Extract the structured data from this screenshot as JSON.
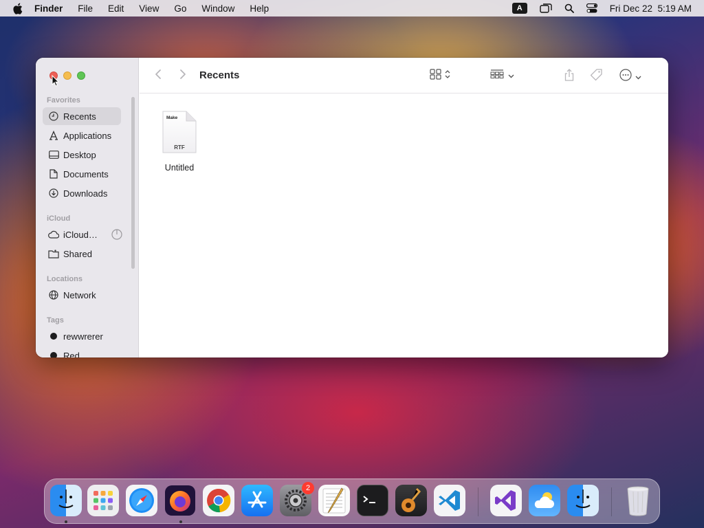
{
  "menubar": {
    "app_name": "Finder",
    "items": [
      "File",
      "Edit",
      "View",
      "Go",
      "Window",
      "Help"
    ],
    "keyboard_indicator": "A",
    "clock": "Fri Dec 22  5:19 AM",
    "icons": [
      "apple-icon",
      "screen-mirroring-icon",
      "spotlight-icon",
      "control-center-icon"
    ]
  },
  "window": {
    "title": "Recents",
    "sidebar": {
      "favorites_header": "Favorites",
      "favorites": [
        {
          "label": "Recents",
          "icon": "clock-icon",
          "selected": true
        },
        {
          "label": "Applications",
          "icon": "applications-icon"
        },
        {
          "label": "Desktop",
          "icon": "desktop-icon"
        },
        {
          "label": "Documents",
          "icon": "document-icon"
        },
        {
          "label": "Downloads",
          "icon": "download-icon"
        }
      ],
      "icloud_header": "iCloud",
      "icloud": [
        {
          "label": "iCloud…",
          "icon": "cloud-icon"
        },
        {
          "label": "Shared",
          "icon": "shared-folder-icon"
        }
      ],
      "locations_header": "Locations",
      "locations": [
        {
          "label": "Network",
          "icon": "globe-icon"
        }
      ],
      "tags_header": "Tags",
      "tags": [
        {
          "label": "rewwrerer",
          "color": "#1d1d1f"
        },
        {
          "label": "Red",
          "color": "#1d1d1f"
        }
      ]
    },
    "files": [
      {
        "name": "Untitled",
        "type_label": "RTF",
        "header_label": "Make"
      }
    ]
  },
  "dock": {
    "apps": [
      "Finder",
      "Launchpad",
      "Safari",
      "Firefox",
      "Chrome",
      "App Store",
      "System Settings",
      "TextEdit",
      "Terminal",
      "GarageBand",
      "Visual Studio Code",
      "Visual Studio",
      "Weather",
      "Finder 2",
      "Trash"
    ],
    "settings_badge": "2"
  }
}
